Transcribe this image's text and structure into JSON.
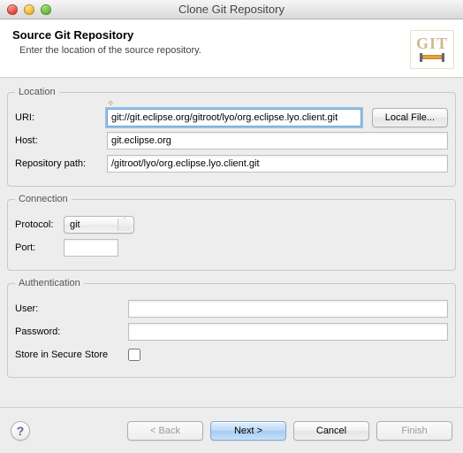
{
  "window": {
    "title": "Clone Git Repository"
  },
  "header": {
    "title": "Source Git Repository",
    "subtitle": "Enter the location of the source repository.",
    "logo_text": "GIT"
  },
  "location": {
    "legend": "Location",
    "uri_label": "URI:",
    "uri_value": "git://git.eclipse.org/gitroot/lyo/org.eclipse.lyo.client.git",
    "local_file_btn": "Local File...",
    "host_label": "Host:",
    "host_value": "git.eclipse.org",
    "repo_path_label": "Repository path:",
    "repo_path_value": "/gitroot/lyo/org.eclipse.lyo.client.git"
  },
  "connection": {
    "legend": "Connection",
    "protocol_label": "Protocol:",
    "protocol_value": "git",
    "port_label": "Port:",
    "port_value": ""
  },
  "authentication": {
    "legend": "Authentication",
    "user_label": "User:",
    "user_value": "",
    "password_label": "Password:",
    "password_value": "",
    "store_label": "Store in Secure Store",
    "store_checked": false
  },
  "footer": {
    "help_glyph": "?",
    "back": "< Back",
    "next": "Next >",
    "cancel": "Cancel",
    "finish": "Finish"
  }
}
